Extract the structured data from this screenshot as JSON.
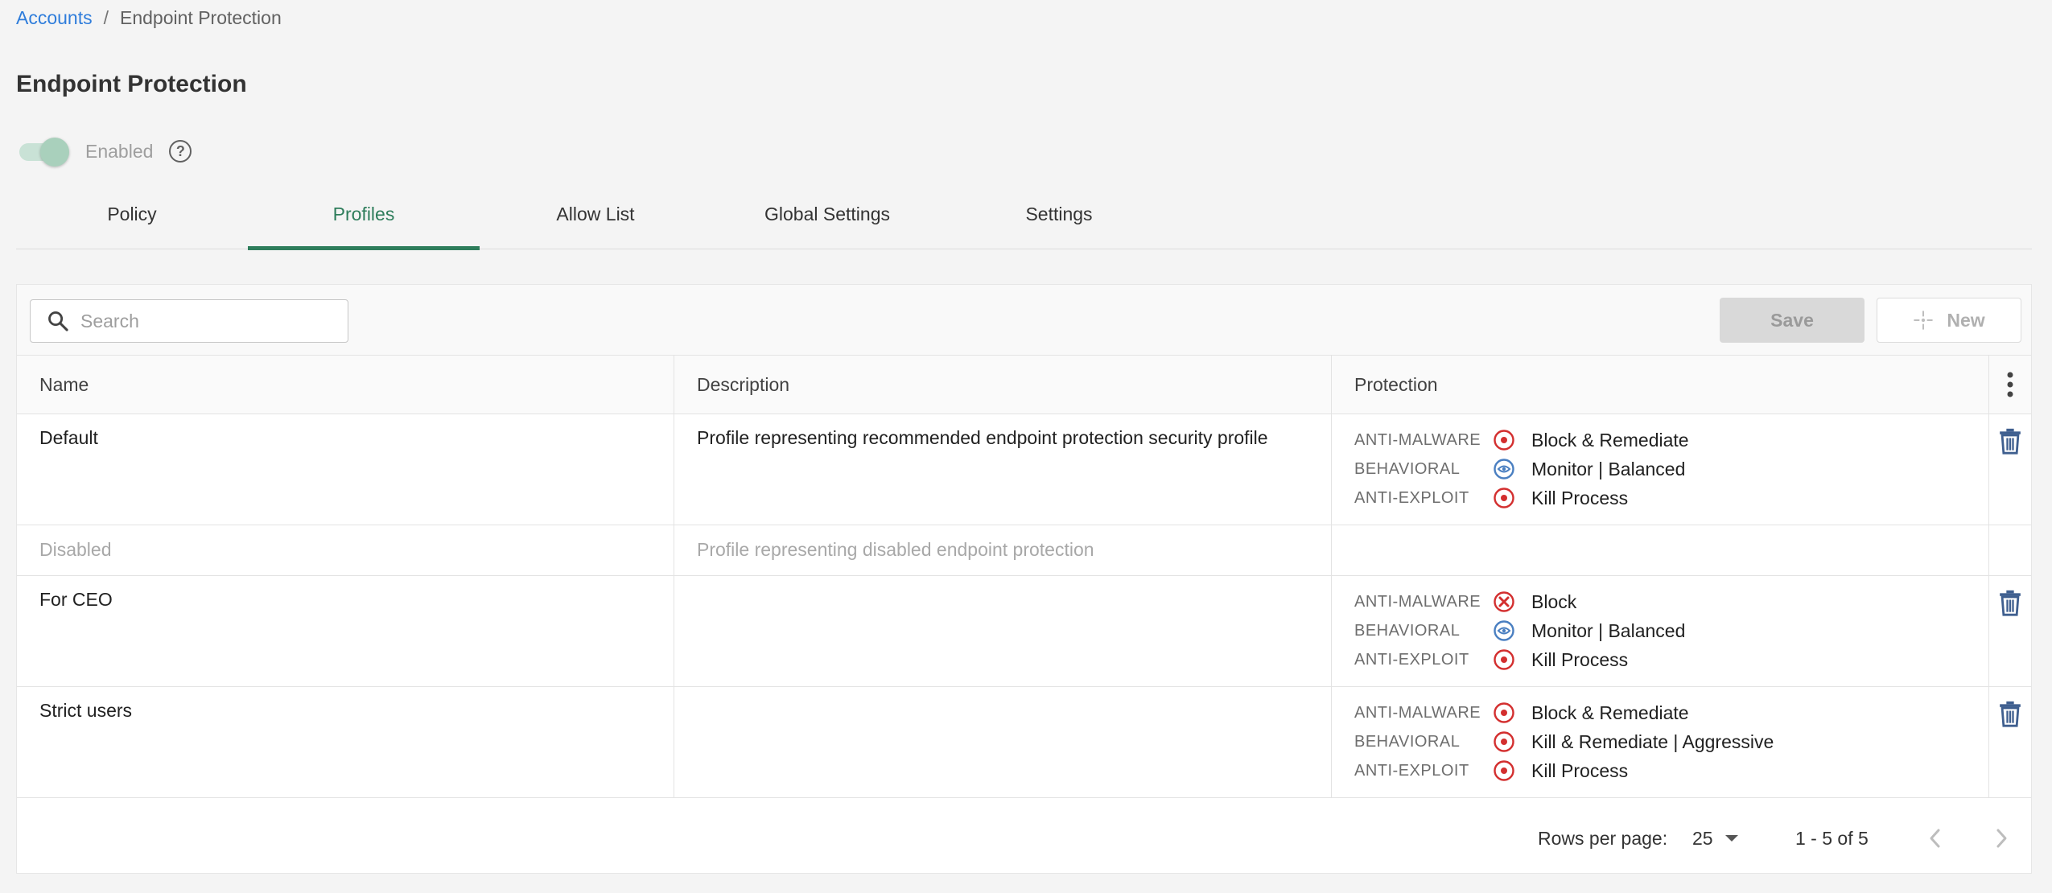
{
  "breadcrumb": {
    "parent": "Accounts",
    "separator": "/",
    "current": "Endpoint Protection"
  },
  "page_title": "Endpoint Protection",
  "toggle": {
    "label": "Enabled",
    "on": true,
    "help_icon": "question-circle-icon"
  },
  "tabs": [
    {
      "label": "Policy",
      "active": false
    },
    {
      "label": "Profiles",
      "active": true
    },
    {
      "label": "Allow List",
      "active": false
    },
    {
      "label": "Global Settings",
      "active": false
    },
    {
      "label": "Settings",
      "active": false
    }
  ],
  "toolbar": {
    "search_placeholder": "Search",
    "save_label": "Save",
    "new_label": "New"
  },
  "table": {
    "columns": [
      "Name",
      "Description",
      "Protection"
    ],
    "rows": [
      {
        "name": "Default",
        "description": "Profile representing recommended endpoint protection security profile",
        "disabled": false,
        "protection": [
          {
            "category": "ANTI-MALWARE",
            "icon": "target-red-icon",
            "value": "Block & Remediate"
          },
          {
            "category": "BEHAVIORAL",
            "icon": "eye-blue-icon",
            "value": "Monitor | Balanced"
          },
          {
            "category": "ANTI-EXPLOIT",
            "icon": "target-red-icon",
            "value": "Kill Process"
          }
        ]
      },
      {
        "name": "Disabled",
        "description": "Profile representing disabled endpoint protection",
        "disabled": true,
        "protection": []
      },
      {
        "name": "For CEO",
        "description": "",
        "disabled": false,
        "protection": [
          {
            "category": "ANTI-MALWARE",
            "icon": "x-circle-red-icon",
            "value": "Block"
          },
          {
            "category": "BEHAVIORAL",
            "icon": "eye-blue-icon",
            "value": "Monitor | Balanced"
          },
          {
            "category": "ANTI-EXPLOIT",
            "icon": "target-red-icon",
            "value": "Kill Process"
          }
        ]
      },
      {
        "name": "Strict users",
        "description": "",
        "disabled": false,
        "protection": [
          {
            "category": "ANTI-MALWARE",
            "icon": "target-red-icon",
            "value": "Block & Remediate"
          },
          {
            "category": "BEHAVIORAL",
            "icon": "target-red-icon",
            "value": "Kill & Remediate | Aggressive"
          },
          {
            "category": "ANTI-EXPLOIT",
            "icon": "target-red-icon",
            "value": "Kill Process"
          }
        ]
      }
    ]
  },
  "footer": {
    "rows_per_page_label": "Rows per page:",
    "rows_per_page_value": "25",
    "range": "1 - 5 of 5"
  },
  "colors": {
    "link": "#2f7ddb",
    "accent_green": "#2e7d5b",
    "danger_red": "#d32f2f",
    "info_blue": "#4a7fc1",
    "trash_blue": "#3f5f8f"
  }
}
